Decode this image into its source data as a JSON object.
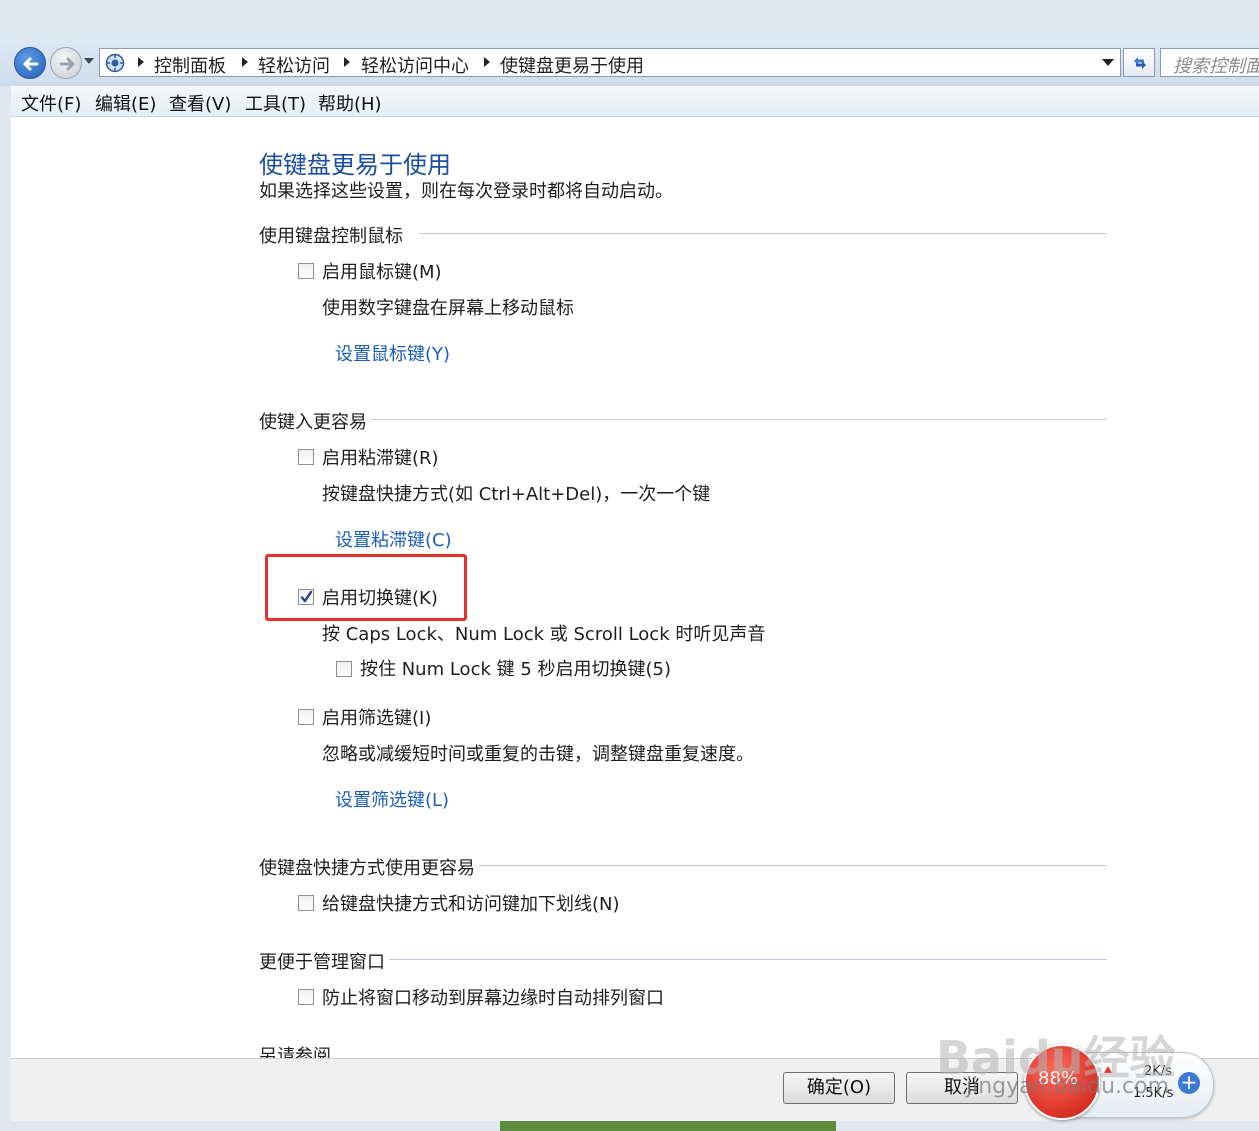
{
  "address": {
    "breadcrumbs": [
      "控制面板",
      "轻松访问",
      "轻松访问中心",
      "使键盘更易于使用"
    ],
    "search_placeholder": "搜索控制面板"
  },
  "menu": [
    "文件(F)",
    "编辑(E)",
    "查看(V)",
    "工具(T)",
    "帮助(H)"
  ],
  "page": {
    "title": "使键盘更易于使用",
    "subtitle": "如果选择这些设置，则在每次登录时都将自动启动。"
  },
  "sections": {
    "mouse": {
      "heading": "使用键盘控制鼠标",
      "mouse_keys_label": "启用鼠标键(M)",
      "mouse_keys_checked": false,
      "mouse_keys_desc": "使用数字键盘在屏幕上移动鼠标",
      "mouse_keys_link": "设置鼠标键(Y)"
    },
    "typing": {
      "heading": "使键入更容易",
      "sticky_label": "启用粘滞键(R)",
      "sticky_checked": false,
      "sticky_desc": "按键盘快捷方式(如 Ctrl+Alt+Del)，一次一个键",
      "sticky_link": "设置粘滞键(C)",
      "toggle_label": "启用切换键(K)",
      "toggle_checked": true,
      "toggle_desc": "按 Caps Lock、Num Lock 或 Scroll Lock 时听见声音",
      "numlock_label": "按住 Num Lock 键 5 秒启用切换键(5)",
      "numlock_checked": false,
      "filter_label": "启用筛选键(I)",
      "filter_checked": false,
      "filter_desc": "忽略或减缓短时间或重复的击键，调整键盘重复速度。",
      "filter_link": "设置筛选键(L)"
    },
    "shortcuts": {
      "heading": "使键盘快捷方式使用更容易",
      "underline_label": "给键盘快捷方式和访问键加下划线(N)",
      "underline_checked": false
    },
    "windows": {
      "heading": "更便于管理窗口",
      "snap_label": "防止将窗口移动到屏幕边缘时自动排列窗口",
      "snap_checked": false
    },
    "see_also": {
      "heading": "另请参阅"
    }
  },
  "footer": {
    "ok_label": "确定(O)",
    "cancel_label": "取消"
  },
  "overlay": {
    "watermark": "Baidu经验",
    "watermark_url": "jingyan.baidu.com",
    "speed_percent": "88%",
    "upload_speed": "2K/s",
    "download_speed": "1.5K/s"
  },
  "colors": {
    "title_blue": "#1a4fa0",
    "link_blue": "#1c5fb9",
    "highlight_red": "#e8302a"
  }
}
